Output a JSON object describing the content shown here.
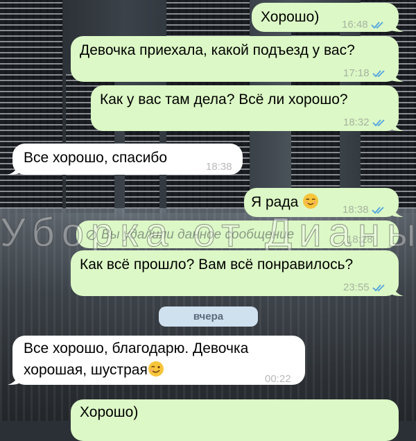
{
  "messages": [
    {
      "id": "m1",
      "dir": "out",
      "text": "Хорошо)",
      "time": "16:48",
      "read": true
    },
    {
      "id": "m2",
      "dir": "out",
      "text": "Девочка приехала, какой подъезд у вас?",
      "time": "17:18",
      "read": true
    },
    {
      "id": "m3",
      "dir": "out",
      "text": "Как у вас там дела? Всё ли хорошо?",
      "time": "18:32",
      "read": true
    },
    {
      "id": "m4",
      "dir": "in",
      "text": "Все хорошо, спасибо",
      "time": "18:38"
    },
    {
      "id": "m5",
      "dir": "out",
      "text": "Я рада",
      "emoji": "relieved-face",
      "time": "18:38",
      "read": true
    },
    {
      "id": "m6",
      "dir": "out",
      "text": "Вы удалили данное сообщение",
      "time": "18:28",
      "deleted": true
    },
    {
      "id": "m7",
      "dir": "out",
      "text": "Как всё прошло? Вам всё понравилось?",
      "time": "23:55",
      "read": true
    },
    {
      "id": "m8",
      "dir": "in",
      "line1": "Все хорошо, благодарю. Девочка",
      "line2": "хорошая, шустрая",
      "emoji": "winking-face",
      "time": "00:22"
    },
    {
      "id": "m9",
      "dir": "out",
      "text": "Хорошо)"
    }
  ],
  "date_separator": "вчера",
  "watermark": "Уборка от Дианы",
  "colors": {
    "outgoing": "#dcf8c6",
    "incoming": "#ffffff",
    "ticks": "#4fa3e0",
    "date_pill": "#cfe0ef"
  }
}
